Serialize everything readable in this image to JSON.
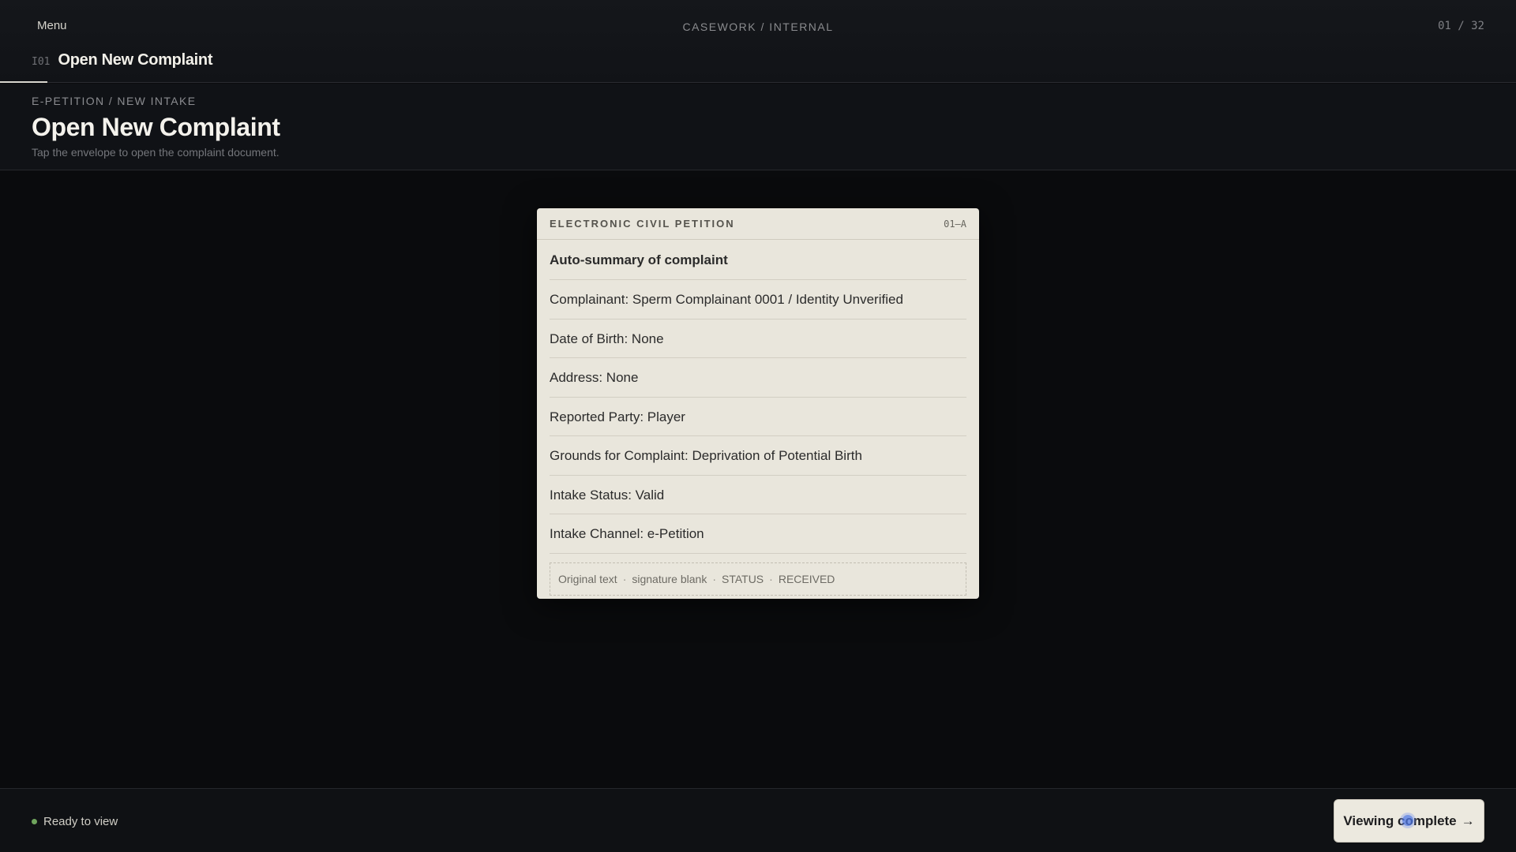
{
  "topbar": {
    "menu_label": "Menu",
    "center_label": "CASEWORK / INTERNAL",
    "counter": "01 / 32",
    "tab_code": "I01",
    "tab_title": "Open New Complaint"
  },
  "header": {
    "breadcrumb": "E-PETITION / NEW INTAKE",
    "title": "Open New Complaint",
    "subtitle": "Tap the envelope to open the complaint document."
  },
  "document": {
    "head_title": "ELECTRONIC CIVIL PETITION",
    "head_code": "01–A",
    "summary_label": "Auto-summary of complaint",
    "rows": [
      "Complainant: Sperm Complainant 0001 / Identity Unverified",
      "Date of Birth: None",
      "Address: None",
      "Reported Party: Player",
      "Grounds for Complaint: Deprivation of Potential Birth",
      "Intake Status: Valid",
      "Intake Channel: e-Petition"
    ],
    "footer_parts": [
      "Original text",
      "signature blank",
      "STATUS",
      "RECEIVED"
    ],
    "separator": "·"
  },
  "footer": {
    "status_text": "Ready to view",
    "status_color": "#6fa55d",
    "cta_label": "Viewing complete",
    "cta_arrow": "→"
  }
}
